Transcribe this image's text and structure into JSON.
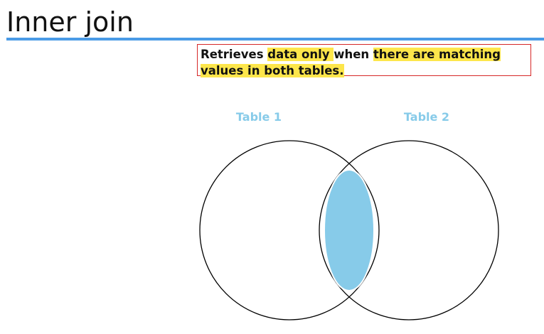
{
  "title": "Inner join",
  "definition": {
    "line1": [
      {
        "text": "Retrieves ",
        "highlight": false
      },
      {
        "text": "data only ",
        "highlight": true
      },
      {
        "text": "when ",
        "highlight": false
      },
      {
        "text": "there are matching",
        "highlight": true
      }
    ],
    "line2": [
      {
        "text": "values in both tables.",
        "highlight": true
      }
    ]
  },
  "venn": {
    "left_label": "Table 1",
    "right_label": "Table 2",
    "intersection_color": "#87cbe9",
    "label_color": "#87cbe9"
  },
  "colors": {
    "title_rule": "#4a9be6",
    "box_border": "#d62828",
    "highlight": "#fde64b"
  }
}
